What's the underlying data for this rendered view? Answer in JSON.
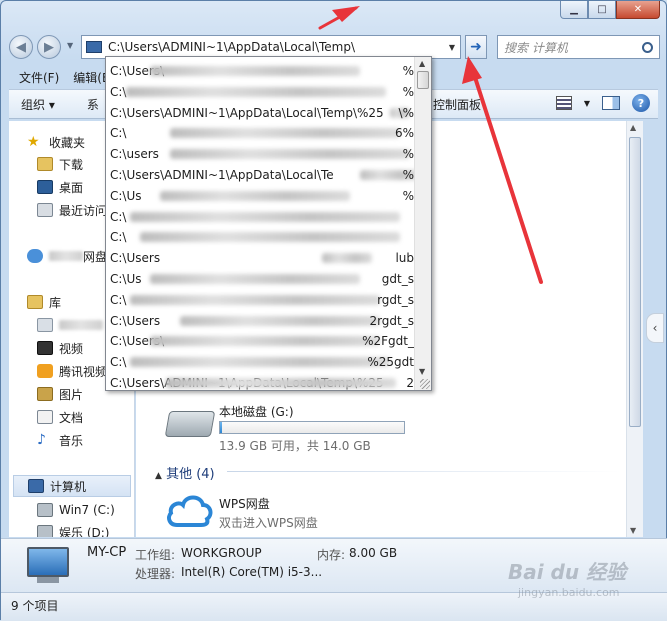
{
  "address": {
    "path": "C:\\Users\\ADMINI~1\\AppData\\Local\\Temp\\"
  },
  "search": {
    "placeholder": "搜索 计算机"
  },
  "menu": {
    "file": "文件(F)",
    "edit": "编辑(E"
  },
  "toolbar": {
    "organize": "组织 ▾",
    "partial_left": "系",
    "control_panel": "控制面板"
  },
  "dropdown": {
    "rows": [
      "C:\\Users\\",
      "C:\\",
      "C:\\Users\\ADMINI~1\\AppData\\Local\\Temp\\%25",
      "C:\\",
      "C:\\users",
      "C:\\Users\\ADMINI~1\\AppData\\Local\\Te",
      "C:\\Us",
      "C:\\",
      "C:\\",
      "C:\\Users",
      "C:\\Us",
      "C:\\",
      "C:\\Users"
    ],
    "tails": [
      "%",
      "%",
      "\\%",
      "6%",
      "%",
      "%",
      "%",
      "",
      "",
      "lub",
      "gdt_s",
      "rgdt_s",
      "2rgdt_s",
      "%2Fgdt_",
      "%25gdt",
      "2"
    ]
  },
  "navpane": {
    "favorites": "收藏夹",
    "downloads": "下载",
    "desktop": "桌面",
    "recent": "最近访问",
    "cloud_suffix": "网盘",
    "library": "库",
    "videos": "视频",
    "tencent_video": "腾讯视频",
    "pictures": "图片",
    "documents": "文档",
    "music": "音乐",
    "computer": "计算机",
    "drive_c": "Win7 (C:)",
    "drive_d": "娱乐 (D:)"
  },
  "content": {
    "drive_g": {
      "name": "本地磁盘 (G:)",
      "info": "13.9 GB 可用，共 14.0 GB",
      "used_fraction": 0.01
    },
    "other_group": "其他 (4)",
    "wps": {
      "name": "WPS网盘",
      "desc": "双击进入WPS网盘"
    }
  },
  "details": {
    "name": "MY-CP",
    "workgroup_label": "工作组:",
    "workgroup": "WORKGROUP",
    "memory_label": "内存:",
    "memory": "8.00 GB",
    "cpu_label": "处理器:",
    "cpu": "Intel(R) Core(TM) i5-3..."
  },
  "status": {
    "items": "9 个项目"
  },
  "colors": {
    "annotation": "#e8343a",
    "accent": "#2364b8"
  },
  "watermark": {
    "main": "Bai du 经验",
    "sub": "jingyan.baidu.com"
  }
}
